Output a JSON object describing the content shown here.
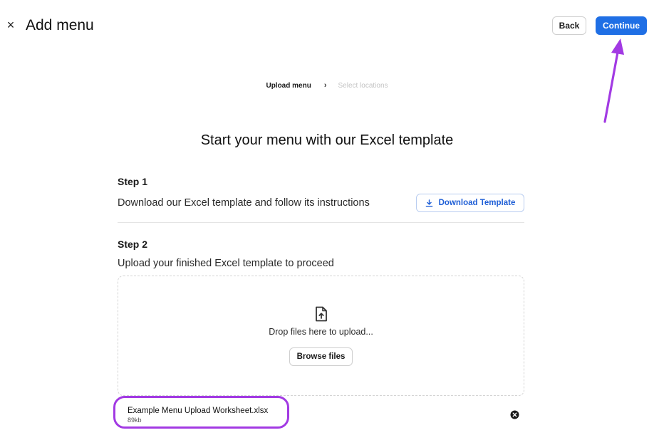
{
  "header": {
    "title": "Add menu",
    "close_symbol": "×",
    "back_label": "Back",
    "continue_label": "Continue",
    "continue_color": "#1f6fe5"
  },
  "breadcrumb": {
    "steps": [
      {
        "label": "Upload menu",
        "state": "active"
      },
      {
        "label": "Select locations",
        "state": "inactive"
      }
    ],
    "separator": "›"
  },
  "main": {
    "heading": "Start your menu with our Excel template",
    "step1": {
      "title": "Step 1",
      "description": "Download our Excel template and follow its instructions",
      "download_label": "Download Template"
    },
    "step2": {
      "title": "Step 2",
      "description": "Upload your finished Excel template to proceed",
      "drop_text": "Drop files here to upload...",
      "browse_label": "Browse files"
    },
    "uploaded_file": {
      "name": "Example Menu Upload Worksheet.xlsx",
      "size": "89kb"
    }
  },
  "icons": {
    "close": "close-icon",
    "download": "download-icon",
    "upload_file": "file-upload-icon",
    "remove": "remove-file-icon"
  },
  "annotation": {
    "highlight_color": "#a23ae3"
  }
}
